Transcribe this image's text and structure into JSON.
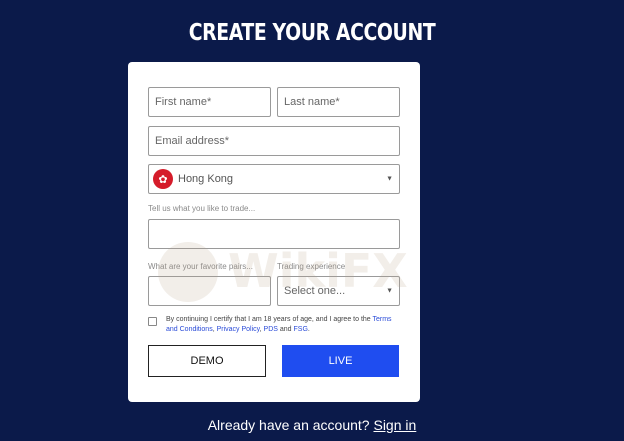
{
  "page": {
    "title": "CREATE YOUR ACCOUNT"
  },
  "form": {
    "first_name_placeholder": "First name*",
    "last_name_placeholder": "Last name*",
    "email_placeholder": "Email address*",
    "country_value": "Hong Kong",
    "trade_label": "Tell us what you like to trade...",
    "trade_value": "",
    "pairs_label": "What are your favorite pairs...",
    "pairs_value": "",
    "experience_label": "Trading experience",
    "experience_value": "Select one...",
    "terms_prefix": "By continuing I certify that I am 18 years of age, and I agree to the ",
    "terms_link": "Terms and Conditions",
    "terms_sep1": ", ",
    "privacy_link": "Privacy Policy",
    "terms_sep2": ", ",
    "pds_link": "PDS",
    "terms_and": " and ",
    "fsg_link": "FSG",
    "terms_end": ".",
    "demo_label": "DEMO",
    "live_label": "LIVE"
  },
  "footer": {
    "prompt": "Already have an account? ",
    "signin_label": "Sign in"
  },
  "icons": {
    "flag": "hong-kong-flag-icon",
    "caret": "chevron-down-icon"
  },
  "colors": {
    "background": "#0b1a4a",
    "live_button": "#1f4df0",
    "link": "#2a4bd8"
  }
}
